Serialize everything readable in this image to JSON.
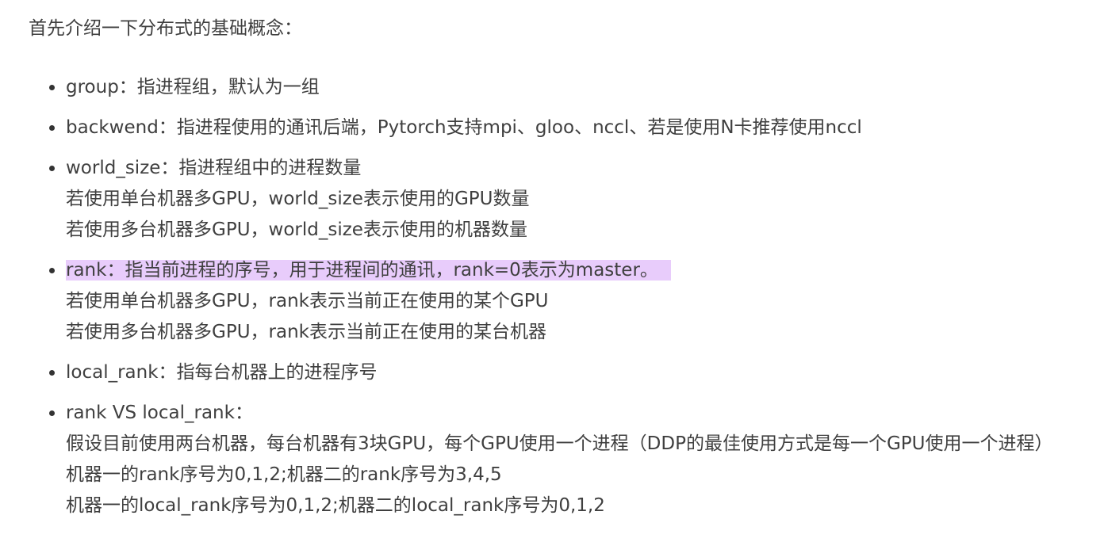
{
  "intro": "首先介绍一下分布式的基础概念：",
  "concepts": [
    {
      "lines": [
        "group：指进程组，默认为一组"
      ]
    },
    {
      "lines": [
        "backwend：指进程使用的通讯后端，Pytorch支持mpi、gloo、nccl、若是使用N卡推荐使用nccl"
      ]
    },
    {
      "lines": [
        "world_size：指进程组中的进程数量",
        "若使用单台机器多GPU，world_size表示使用的GPU数量",
        "若使用多台机器多GPU，world_size表示使用的机器数量"
      ]
    },
    {
      "lines": [
        "rank：指当前进程的序号，用于进程间的通讯，rank=0表示为master。",
        "若使用单台机器多GPU，rank表示当前正在使用的某个GPU",
        "若使用多台机器多GPU，rank表示当前正在使用的某台机器"
      ]
    },
    {
      "lines": [
        "local_rank：指每台机器上的进程序号"
      ]
    },
    {
      "lines": [
        "rank VS local_rank：",
        "假设目前使用两台机器，每台机器有3块GPU，每个GPU使用一个进程（DDP的最佳使用方式是每一个GPU使用一个进程）",
        "机器一的rank序号为0,1,2;机器二的rank序号为3,4,5",
        "机器一的local_rank序号为0,1,2;机器二的local_rank序号为0,1,2"
      ]
    }
  ],
  "colors": {
    "text": "#3f3f3f",
    "highlight": "#e8ccfb",
    "bullet": "#333333"
  }
}
